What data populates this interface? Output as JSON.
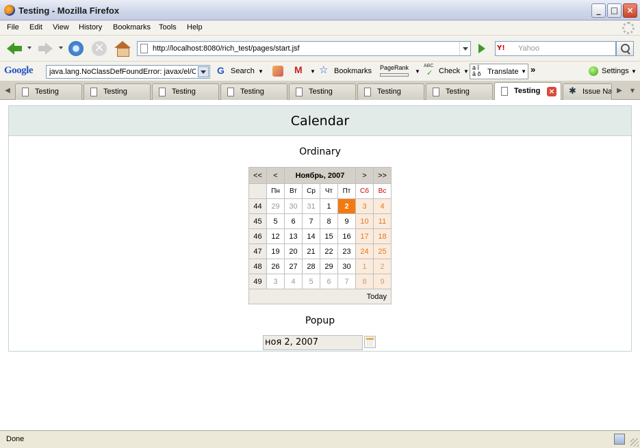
{
  "window": {
    "title": "Testing - Mozilla Firefox",
    "min": "_",
    "max": "□",
    "close": "×"
  },
  "menu": [
    "File",
    "Edit",
    "View",
    "History",
    "Bookmarks",
    "Tools",
    "Help"
  ],
  "nav": {
    "url": "http://localhost:8080/rich_test/pages/start.jsf",
    "search_placeholder": "Yahoo",
    "search_engine": "Y!"
  },
  "google_toolbar": {
    "logo": "Google",
    "field_value": "java.lang.NoClassDefFoundError: javax/el/C",
    "search": "Search",
    "bookmarks": "Bookmarks",
    "pagerank": "PageRank",
    "check": "Check",
    "check_badge": "ABC",
    "translate": "Translate",
    "more": "»",
    "settings": "Settings"
  },
  "tabs": [
    {
      "label": "Testing"
    },
    {
      "label": "Testing"
    },
    {
      "label": "Testing"
    },
    {
      "label": "Testing"
    },
    {
      "label": "Testing"
    },
    {
      "label": "Testing"
    },
    {
      "label": "Testing"
    },
    {
      "label": "Testing",
      "active": true
    },
    {
      "label": "Issue Nav"
    }
  ],
  "page": {
    "header": "Calendar",
    "ordinary_label": "Ordinary",
    "popup_label": "Popup",
    "popup_value": "ноя 2, 2007"
  },
  "calendar": {
    "nav_prev_year": "<<",
    "nav_prev_month": "<",
    "month_year": "Ноябрь, 2007",
    "nav_next_month": ">",
    "nav_next_year": ">>",
    "weekdays": [
      "Пн",
      "Вт",
      "Ср",
      "Чт",
      "Пт",
      "Сб",
      "Вс"
    ],
    "weeks": [
      {
        "num": "44",
        "days": [
          "29",
          "30",
          "31",
          "1",
          "2",
          "3",
          "4"
        ]
      },
      {
        "num": "45",
        "days": [
          "5",
          "6",
          "7",
          "8",
          "9",
          "10",
          "11"
        ]
      },
      {
        "num": "46",
        "days": [
          "12",
          "13",
          "14",
          "15",
          "16",
          "17",
          "18"
        ]
      },
      {
        "num": "47",
        "days": [
          "19",
          "20",
          "21",
          "22",
          "23",
          "24",
          "25"
        ]
      },
      {
        "num": "48",
        "days": [
          "26",
          "27",
          "28",
          "29",
          "30",
          "1",
          "2"
        ]
      },
      {
        "num": "49",
        "days": [
          "3",
          "4",
          "5",
          "6",
          "7",
          "8",
          "9"
        ]
      }
    ],
    "selected_day": "2",
    "today_button": "Today",
    "colors": {
      "today_bg": "#f37a10",
      "weekend_text": "#e27a1f",
      "weekend_bg": "#fbebdc"
    }
  },
  "status": {
    "text": "Done"
  }
}
